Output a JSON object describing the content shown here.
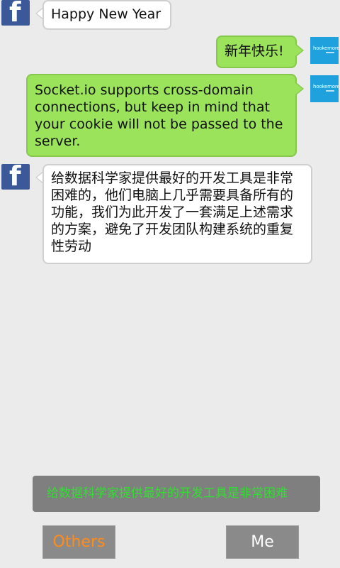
{
  "messages": [
    {
      "side": "left",
      "avatar": "facebook-logo",
      "text": "Happy New Year"
    },
    {
      "side": "right",
      "avatar": "hookemore-logo",
      "text": "新年快乐!"
    },
    {
      "side": "right",
      "avatar": "hookemore-logo",
      "text": "Socket.io supports cross-domain connections, but keep in mind that your cookie will not be passed to the server."
    },
    {
      "side": "left",
      "avatar": "facebook-logo",
      "text": "给数据科学家提供最好的开发工具是非常困难的，他们电脑上几乎需要具备所有的功能，我们为此开发了一套满足上述需求的方案，避免了开发团队构建系统的重复性劳动"
    }
  ],
  "avatars": {
    "facebook_glyph": "f",
    "hookemore_text": "hookemore"
  },
  "input": {
    "value": "给数据科学家提供最好的开发工具是非常困难",
    "text_color": "#33dd33"
  },
  "buttons": {
    "others_label": "Others",
    "me_label": "Me"
  },
  "colors": {
    "background": "#ebebeb",
    "left_bubble": "#ffffff",
    "right_bubble": "#9be35b",
    "facebook_blue": "#3b5998",
    "others_text": "#ff8c1a"
  }
}
